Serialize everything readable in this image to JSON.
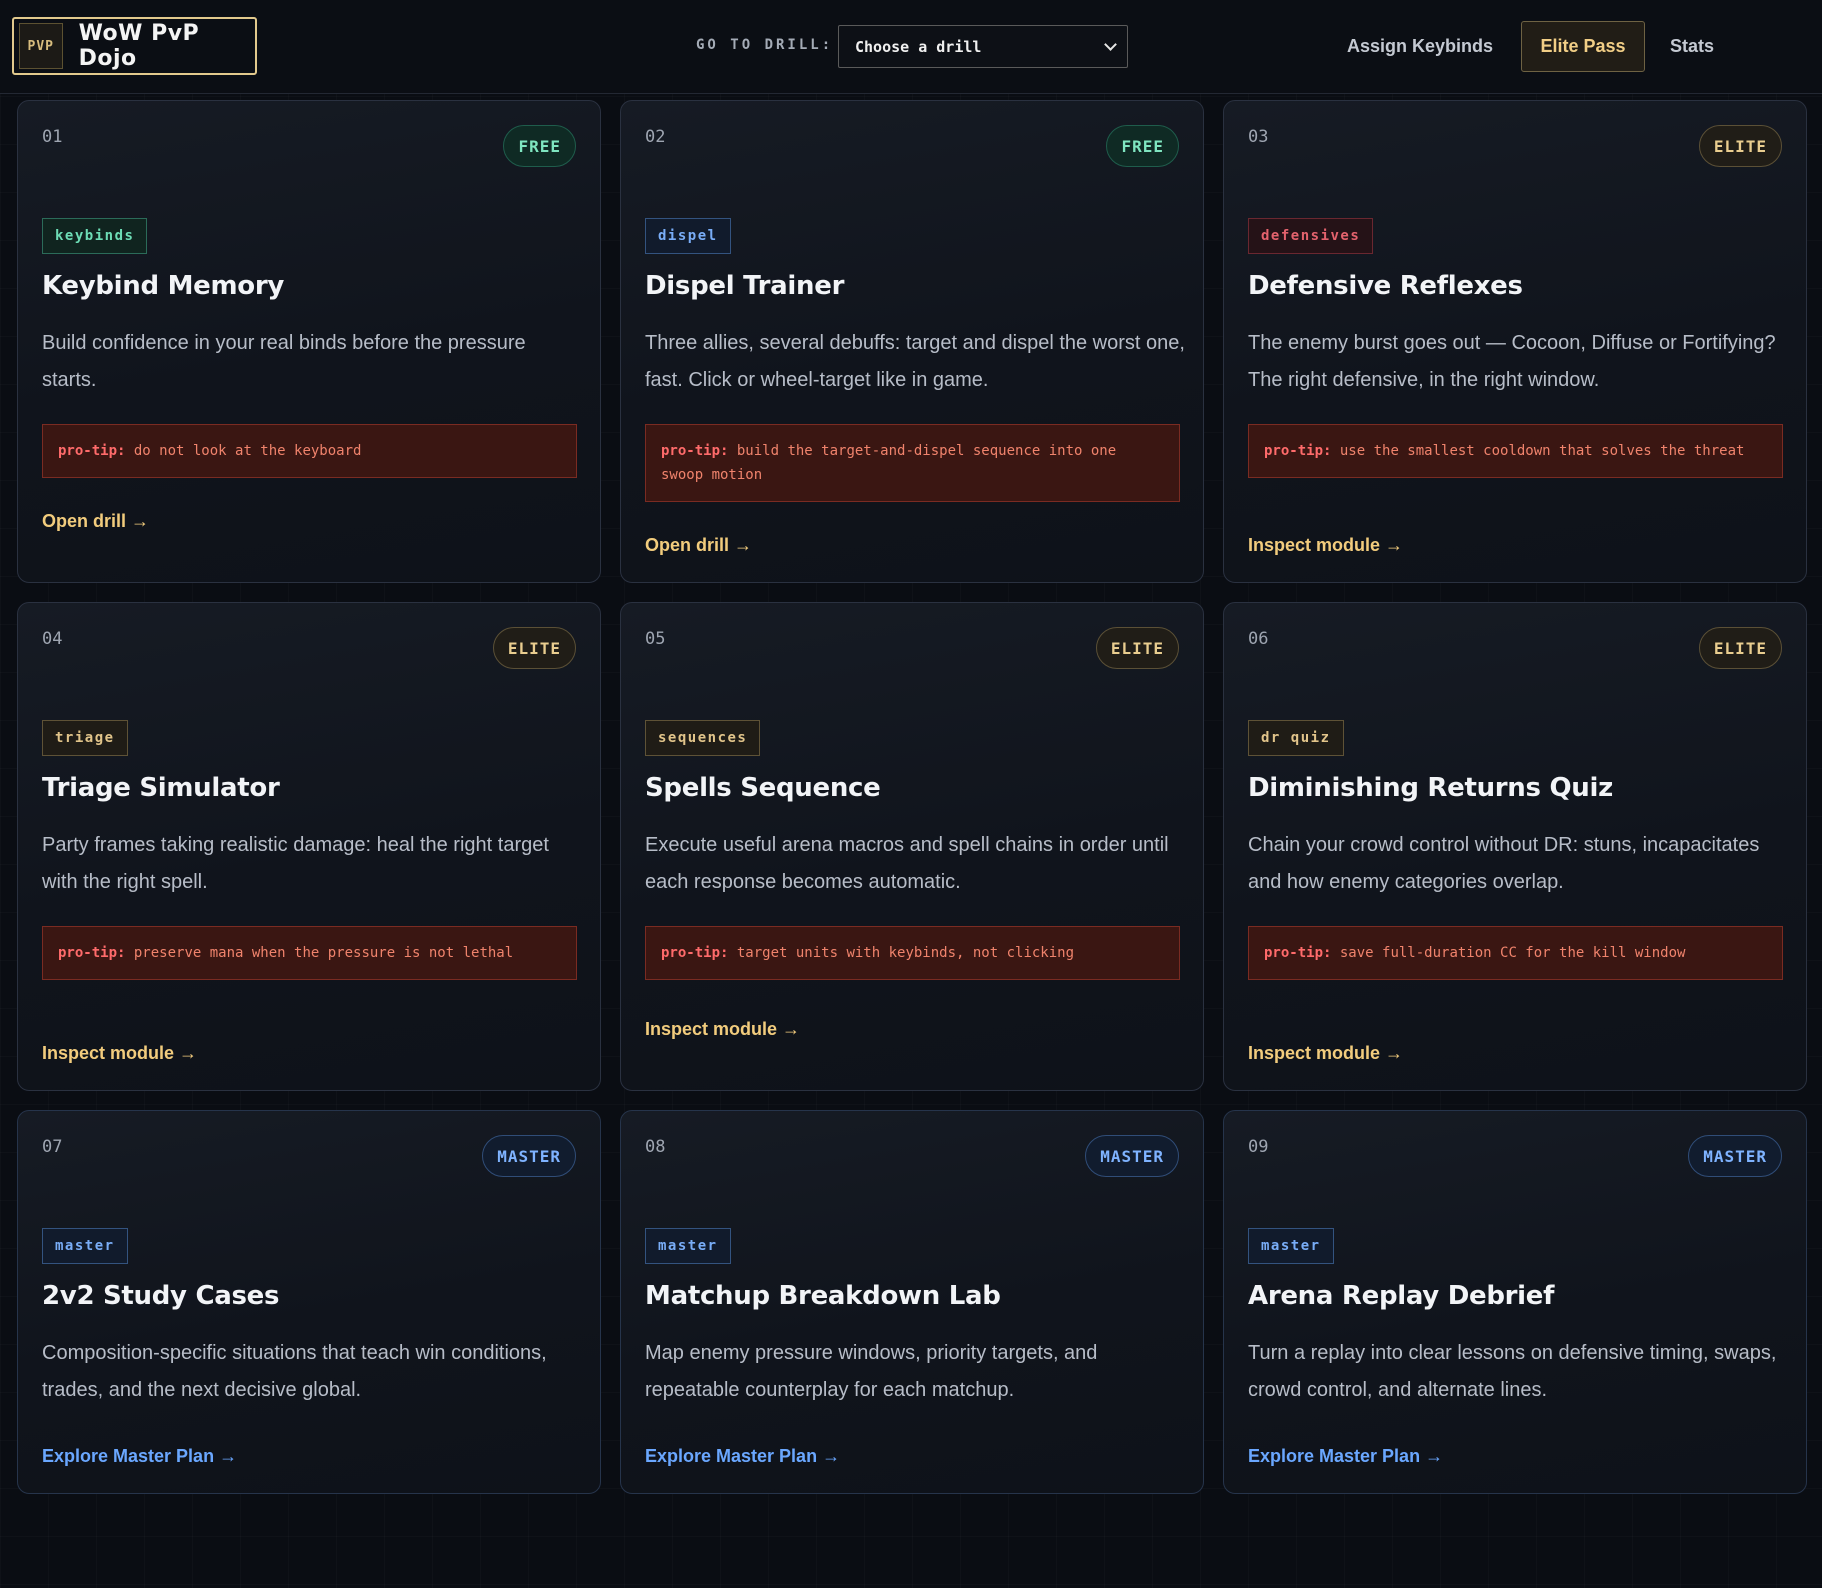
{
  "header": {
    "logo_mark": "PVP",
    "app_name": "WoW PvP Dojo",
    "goto_label": "GO TO DRILL:",
    "goto_selected": "Choose a drill",
    "nav": {
      "assign": "Assign Keybinds",
      "elite": "Elite Pass",
      "stats": "Stats"
    }
  },
  "cards": [
    {
      "num": "01",
      "badge": "FREE",
      "tag": "keybinds",
      "title": "Keybind Memory",
      "desc": "Build confidence in your real binds before the pressure starts.",
      "tip_label": "pro-tip:",
      "tip": "do not look at the keyboard",
      "action": "Open drill →"
    },
    {
      "num": "02",
      "badge": "FREE",
      "tag": "dispel",
      "title": "Dispel Trainer",
      "desc": "Three allies, several debuffs: target and dispel the worst one, fast. Click or wheel-target like in game.",
      "tip_label": "pro-tip:",
      "tip": "build the target-and-dispel sequence into one swoop motion",
      "action": "Open drill →"
    },
    {
      "num": "03",
      "badge": "ELITE",
      "tag": "defensives",
      "title": "Defensive Reflexes",
      "desc": "The enemy burst goes out — Cocoon, Diffuse or Fortifying? The right defensive, in the right window.",
      "tip_label": "pro-tip:",
      "tip": "use the smallest cooldown that solves the threat",
      "action": "Inspect module →"
    },
    {
      "num": "04",
      "badge": "ELITE",
      "tag": "triage",
      "title": "Triage Simulator",
      "desc": "Party frames taking realistic damage: heal the right target with the right spell.",
      "tip_label": "pro-tip:",
      "tip": "preserve mana when the pressure is not lethal",
      "action": "Inspect module →"
    },
    {
      "num": "05",
      "badge": "ELITE",
      "tag": "sequences",
      "title": "Spells Sequence",
      "desc": "Execute useful arena macros and spell chains in order until each response becomes automatic.",
      "tip_label": "pro-tip:",
      "tip": "target units with keybinds, not clicking",
      "action": "Inspect module →"
    },
    {
      "num": "06",
      "badge": "ELITE",
      "tag": "dr quiz",
      "title": "Diminishing Returns Quiz",
      "desc": "Chain your crowd control without DR: stuns, incapacitates and how enemy categories overlap.",
      "tip_label": "pro-tip:",
      "tip": "save full-duration CC for the kill window",
      "action": "Inspect module →"
    },
    {
      "num": "07",
      "badge": "MASTER",
      "tag": "master",
      "title": "2v2 Study Cases",
      "desc": "Composition-specific situations that teach win conditions, trades, and the next decisive global.",
      "action": "Explore Master Plan →"
    },
    {
      "num": "08",
      "badge": "MASTER",
      "tag": "master",
      "title": "Matchup Breakdown Lab",
      "desc": "Map enemy pressure windows, priority targets, and repeatable counterplay for each matchup.",
      "action": "Explore Master Plan →"
    },
    {
      "num": "09",
      "badge": "MASTER",
      "tag": "master",
      "title": "Arena Replay Debrief",
      "desc": "Turn a replay into clear lessons on defensive timing, swaps, crowd control, and alternate lines.",
      "action": "Explore Master Plan →"
    }
  ]
}
